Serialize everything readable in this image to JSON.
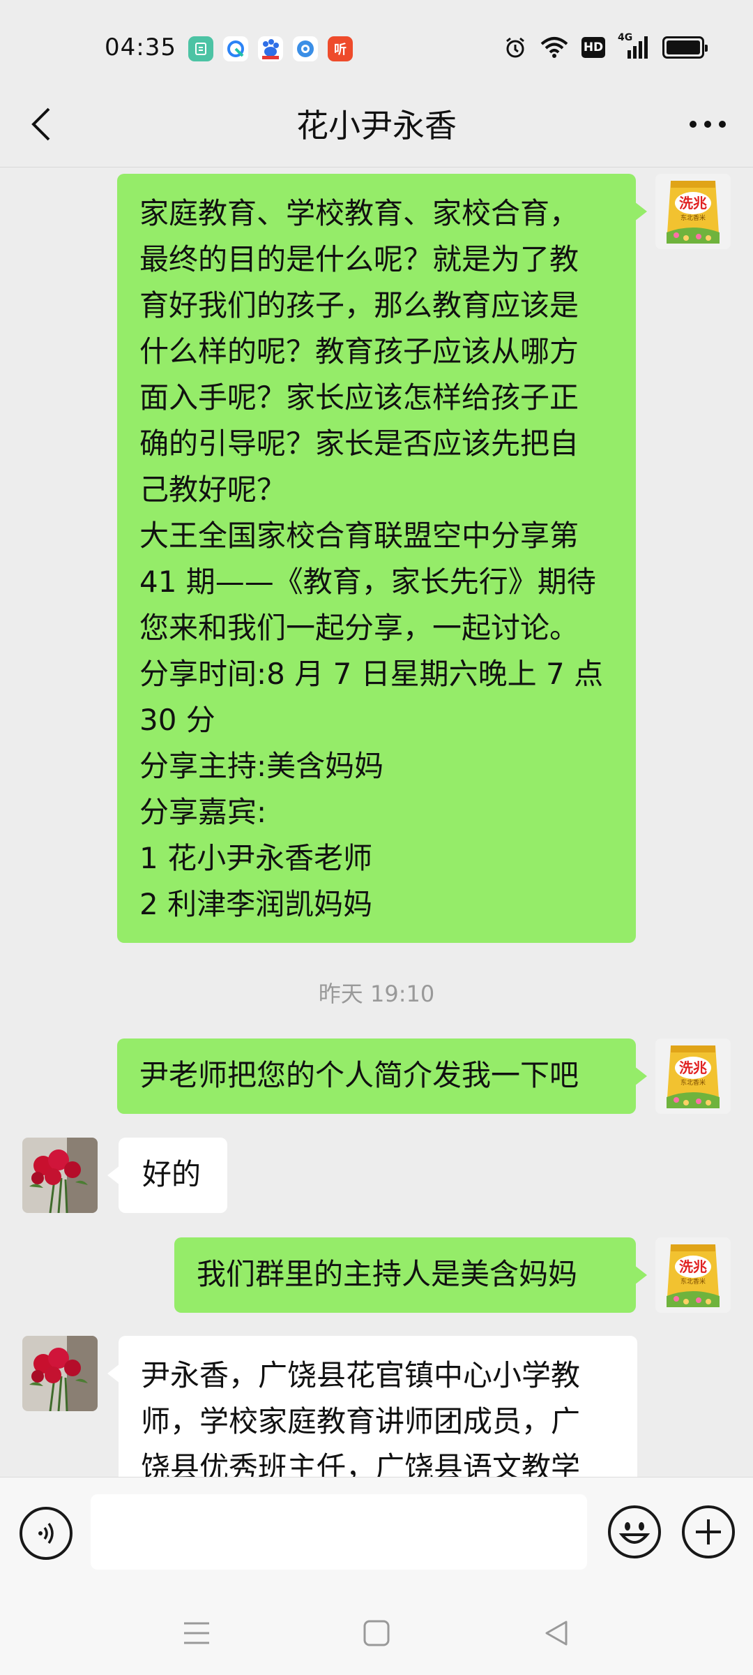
{
  "status_bar": {
    "time": "04:35",
    "app_icons": [
      {
        "name": "bank-app-icon",
        "color": "#4cc3a4"
      },
      {
        "name": "browser-app-icon",
        "color": "#2b83f6"
      },
      {
        "name": "baidu-app-icon",
        "color": "#2f6fe7"
      },
      {
        "name": "camera-app-icon",
        "color": "#3a8ee6"
      },
      {
        "name": "ting-app-icon",
        "color": "#ee4b2b",
        "glyph": "听"
      }
    ],
    "hd_label": "HD",
    "network_label": "4G"
  },
  "header": {
    "title": "花小尹永香"
  },
  "messages": {
    "m1": {
      "sender": "me",
      "lines": [
        "家庭教育、学校教育、家校合育，",
        "最终的目的是什么呢？就是为了教",
        "育好我们的孩子，那么教育应该是",
        "什么样的呢？教育孩子应该从哪方",
        "面入手呢？家长应该怎样给孩子正",
        "确的引导呢？家长是否应该先把自",
        "己教好呢？",
        "大王全国家校合育联盟空中分享第",
        "41 期——《教育，家长先行》期待",
        "您来和我们一起分享，一起讨论。",
        "分享时间:8 月 7 日星期六晚上 7 点",
        "30 分",
        "分享主持:美含妈妈",
        "分享嘉宾:",
        "1 花小尹永香老师",
        "2 利津李润凯妈妈"
      ]
    },
    "timestamp": "昨天 19:10",
    "m2": {
      "sender": "me",
      "text": "尹老师把您的个人简介发我一下吧"
    },
    "m3": {
      "sender": "them",
      "text": "好的"
    },
    "m4": {
      "sender": "me",
      "text": "我们群里的主持人是美含妈妈"
    },
    "m5": {
      "sender": "them",
      "lines": [
        "尹永香，广饶县花官镇中心小学教",
        "师，学校家庭教育讲师团成员，广",
        "饶县优秀班主任，广饶县语文教学"
      ]
    }
  },
  "my_avatar": {
    "brand_text": "洗兆",
    "sub_text": "东北香米"
  },
  "input_bar": {
    "placeholder": ""
  },
  "colors": {
    "my_bubble": "#95ec69",
    "their_bubble": "#ffffff",
    "background": "#ededed"
  }
}
